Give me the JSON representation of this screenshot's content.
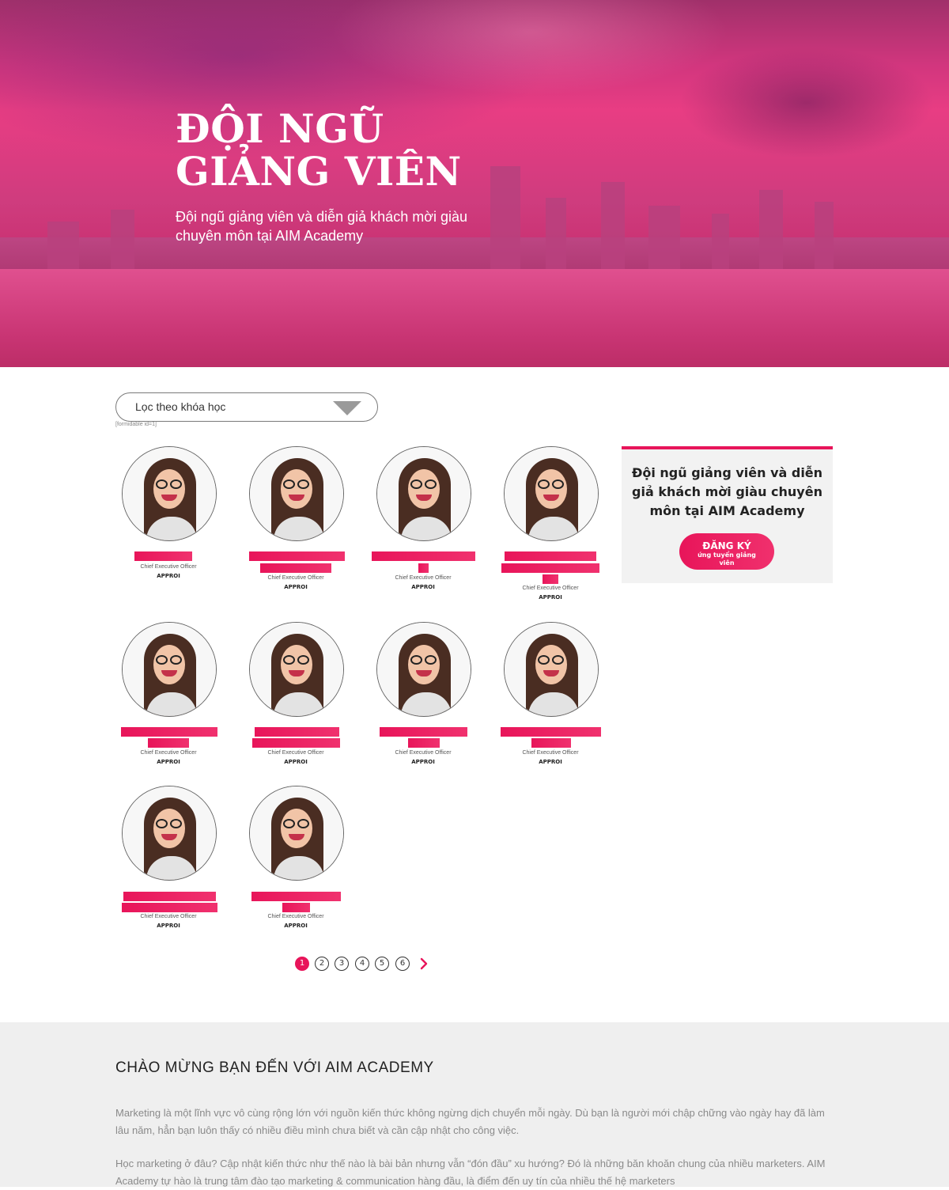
{
  "hero": {
    "title_line1": "ĐỘI NGŨ",
    "title_line2": "GIẢNG VIÊN",
    "subtitle": "Đội ngũ giảng viên và diễn giả khách mời giàu chuyên môn tại AIM Academy"
  },
  "filter": {
    "placeholder": "Lọc theo khóa học",
    "form_note": "[formidable id=1]"
  },
  "instructors": [
    {
      "role": "Chief Executive Officer",
      "company": "APPROI"
    },
    {
      "role": "Chief Executive Officer",
      "company": "APPROI"
    },
    {
      "role": "Chief Executive Officer",
      "company": "APPROI"
    },
    {
      "role": "Chief Executive Officer",
      "company": "APPROI"
    },
    {
      "role": "Chief Executive Officer",
      "company": "APPROI"
    },
    {
      "role": "Chief Executive Officer",
      "company": "APPROI"
    },
    {
      "role": "Chief Executive Officer",
      "company": "APPROI"
    },
    {
      "role": "Chief Executive Officer",
      "company": "APPROI"
    },
    {
      "role": "Chief Executive Officer",
      "company": "APPROI"
    },
    {
      "role": "Chief Executive Officer",
      "company": "APPROI"
    }
  ],
  "sidebar": {
    "text": "Đội ngũ giảng viên và diễn giả khách mời giàu chuyên môn tại AIM Academy",
    "button_label": "ĐĂNG KÝ",
    "button_sub": "ứng tuyển giảng viên"
  },
  "pagination": {
    "pages": [
      "1",
      "2",
      "3",
      "4",
      "5",
      "6"
    ],
    "current": "1",
    "next_icon": "chevron-right-icon"
  },
  "welcome": {
    "heading": "CHÀO MỪNG BẠN ĐẾN VỚI AIM ACADEMY",
    "paragraph1": "Marketing là một lĩnh vực vô cùng rộng lớn với nguồn kiến thức không ngừng dịch chuyển mỗi ngày. Dù bạn là người mới chập chững vào ngày hay đã làm lâu năm, hẳn bạn luôn thấy có nhiều điều mình chưa biết và cần cập nhật cho công việc.",
    "paragraph2": "Học marketing ở đâu? Cập nhật kiến thức như thế nào là bài bản nhưng vẫn “đón đầu” xu hướng? Đó là những băn khoăn chung của nhiều marketers. AIM Academy tự hào là trung tâm đào tạo marketing & communication hàng đầu, là điểm đến uy tín của nhiều thế hệ marketers"
  },
  "colors": {
    "accent": "#e8155a",
    "hero_pink": "#e83d83",
    "section_bg": "#efefef"
  }
}
